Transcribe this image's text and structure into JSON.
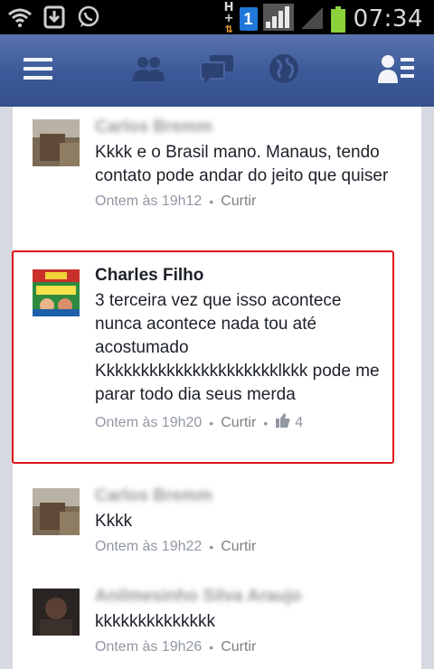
{
  "status_bar": {
    "network_label_1": "H",
    "network_label_2": "+",
    "sim_slot": "1",
    "time": "07:34"
  },
  "header": {
    "icons": [
      "menu-icon",
      "friend-requests-icon",
      "messages-icon",
      "notifications-globe-icon",
      "contacts-list-icon"
    ],
    "brand_color": "#3b5998"
  },
  "comments": [
    {
      "author": "Carlos Bremm",
      "author_obscured": true,
      "text": "Kkkk e o Brasil mano. Manaus, tendo contato pode andar do jeito que quiser",
      "time": "Ontem às 19h12",
      "like_label": "Curtir"
    },
    {
      "author": "Charles Filho",
      "author_obscured": false,
      "text": "3 terceira vez que isso acontece nunca acontece nada tou até acostumado Kkkkkkkkkkkkkkkkkkkkklkkk pode me parar todo dia seus merda",
      "time": "Ontem às 19h20",
      "like_label": "Curtir",
      "like_count": "4",
      "highlighted": true,
      "highlight_color": "#e0141b"
    },
    {
      "author": "Carlos Bremm",
      "author_obscured": true,
      "text": "Kkkk",
      "time": "Ontem às 19h22",
      "like_label": "Curtir"
    },
    {
      "author": "Anilmesinho Silva Araujo",
      "author_obscured": true,
      "text": "kkkkkkkkkkkkkk",
      "time": "Ontem às 19h26",
      "like_label": "Curtir"
    }
  ]
}
